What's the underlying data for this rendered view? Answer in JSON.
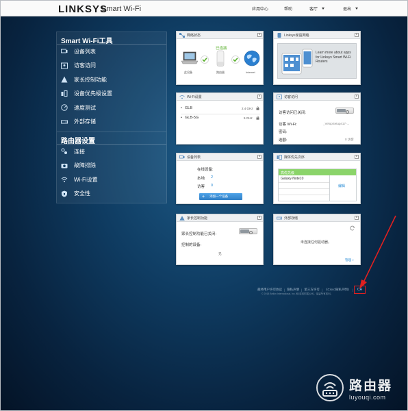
{
  "header": {
    "brand": "LINKSYS",
    "product": "Smart Wi-Fi",
    "help_center": "应用中心",
    "help": "帮助",
    "user": "客厅",
    "logout": "退出"
  },
  "sidebar": {
    "tools_title": "Smart Wi-Fi工具",
    "tools": [
      {
        "label": "设备列表",
        "icon": "device-list-icon"
      },
      {
        "label": "访客访问",
        "icon": "guest-access-icon"
      },
      {
        "label": "家长控制功能",
        "icon": "parental-controls-icon"
      },
      {
        "label": "设备优先级设置",
        "icon": "media-prioritization-icon"
      },
      {
        "label": "速度测试",
        "icon": "speed-test-icon"
      },
      {
        "label": "外部存储",
        "icon": "external-storage-icon"
      }
    ],
    "router_title": "路由器设置",
    "router": [
      {
        "label": "连接",
        "icon": "connectivity-icon"
      },
      {
        "label": "故障排除",
        "icon": "troubleshooting-icon"
      },
      {
        "label": "Wi-Fi设置",
        "icon": "wifi-icon"
      },
      {
        "label": "安全性",
        "icon": "security-icon"
      }
    ]
  },
  "network_status": {
    "title": "网络状态",
    "connected": "已连接",
    "this_device": "此设备",
    "router": "路由器",
    "internet": "Internet"
  },
  "linksys_app": {
    "title": "Linksys家庭网络",
    "promo": "Learn more about apps for Linksys Smart Wi-Fi Routers"
  },
  "wifi_settings": {
    "title": "Wi-Fi设置",
    "networks": [
      {
        "name": "GLB",
        "band": "2.4 GHz"
      },
      {
        "name": "GLB-5G",
        "band": "5 GHz"
      }
    ]
  },
  "guest_access": {
    "title": "访客访问",
    "status_label": "访客访问已关闭:",
    "wifi_label": "访客 Wi-Fi:",
    "wifi_value": "_VelopSetup417-...",
    "password_label": "密码:",
    "allowed_label": "选额:",
    "allowed_value": "0 访客"
  },
  "device_list": {
    "title": "设备列表",
    "online_label": "在线设备:",
    "local_label": "本地",
    "local_value": "2",
    "guest_label": "访客",
    "guest_value": "0",
    "add_button": "添加一个设备"
  },
  "media_priority": {
    "title": "媒体优先次序",
    "high_priority": "高优先级",
    "device": "Galaxy-Note10",
    "edit": "编辑"
  },
  "parental_controls": {
    "title": "家长控制功能",
    "status_label": "家长控制功能已关闭:",
    "controlled_label": "控制的设备:",
    "controlled_value": "无"
  },
  "external_storage": {
    "title": "外部存储",
    "message": "未连接任何驱动器。",
    "manage": "管理 »"
  },
  "footer": {
    "links": [
      "最终用户许可协议",
      "隐私声明",
      "第三方许可",
      "《Cisco隐私声明》",
      "CA"
    ],
    "copyright": "© 2018 Belkin International, Inc. 和/或其附属公司。保留所有权利。"
  },
  "watermark": {
    "text": "路由器",
    "url": "luyouqi.com"
  },
  "colors": {
    "background": "#0f3c62",
    "accent": "#2f8fd6",
    "green": "#5bb12f",
    "highlight": "#e02020"
  }
}
